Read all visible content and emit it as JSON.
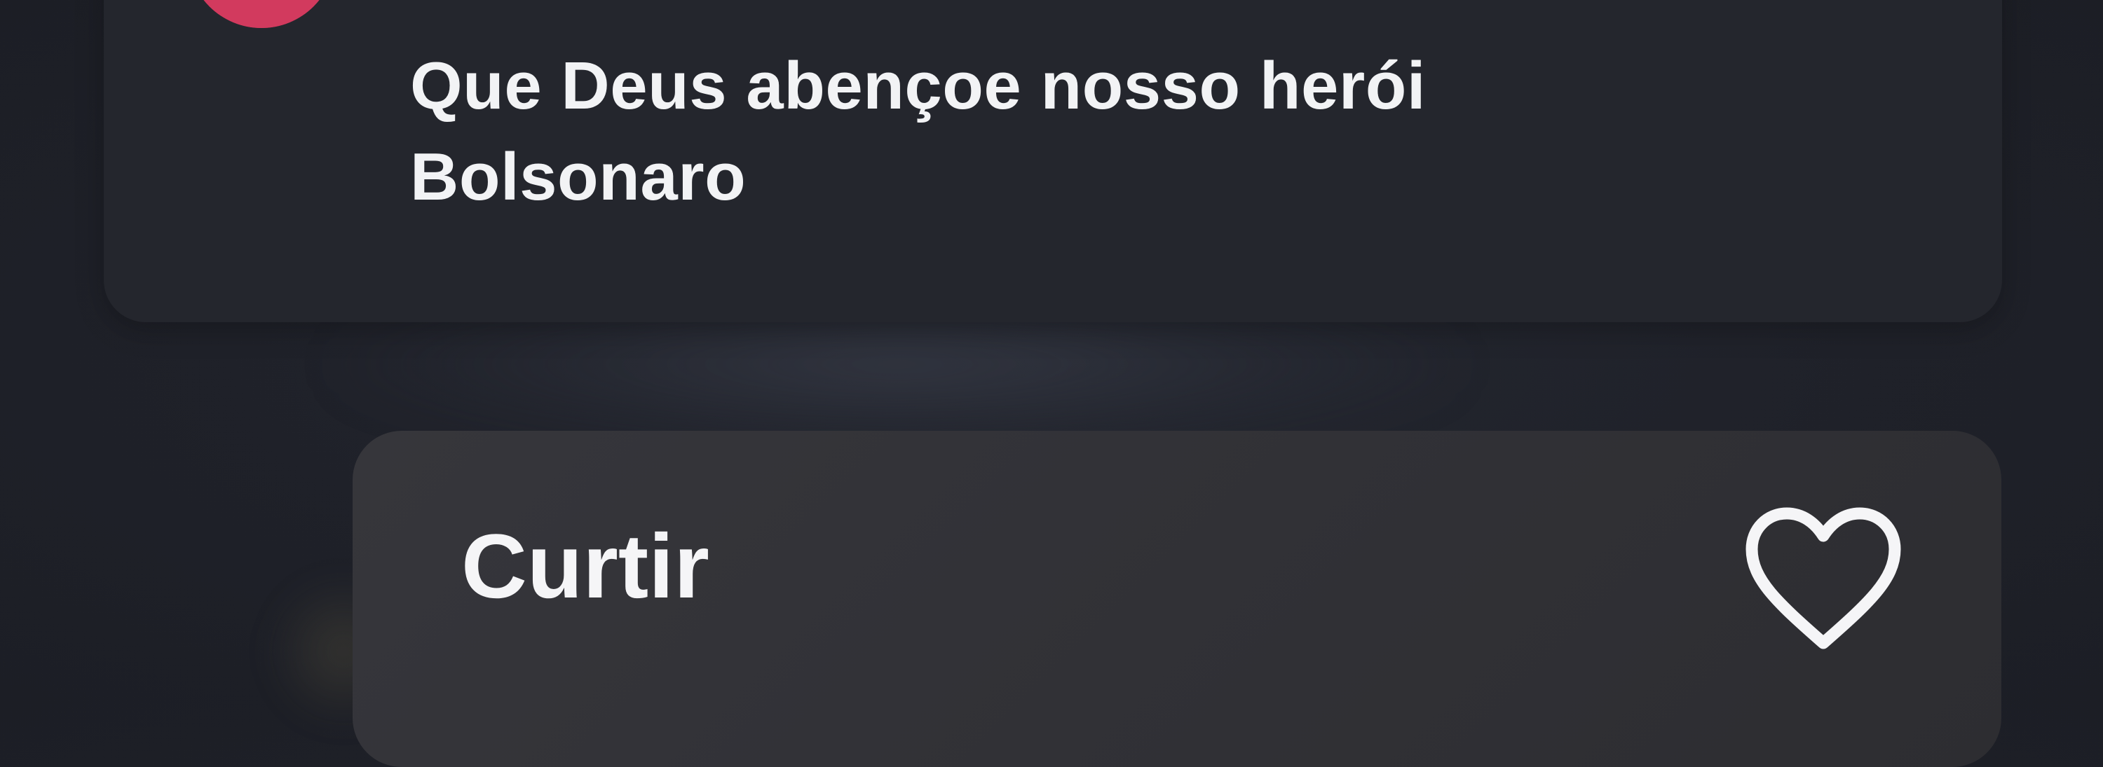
{
  "comment": {
    "text_line1": "Que Deus abençoe nosso herói",
    "text_line2": "Bolsonaro"
  },
  "action_menu": {
    "like_label": "Curtir",
    "like_icon": "heart-outline-icon"
  },
  "colors": {
    "background": "#1f2129",
    "bubble": "#24262d",
    "menu": "#333338",
    "text": "#f2f3f5"
  }
}
